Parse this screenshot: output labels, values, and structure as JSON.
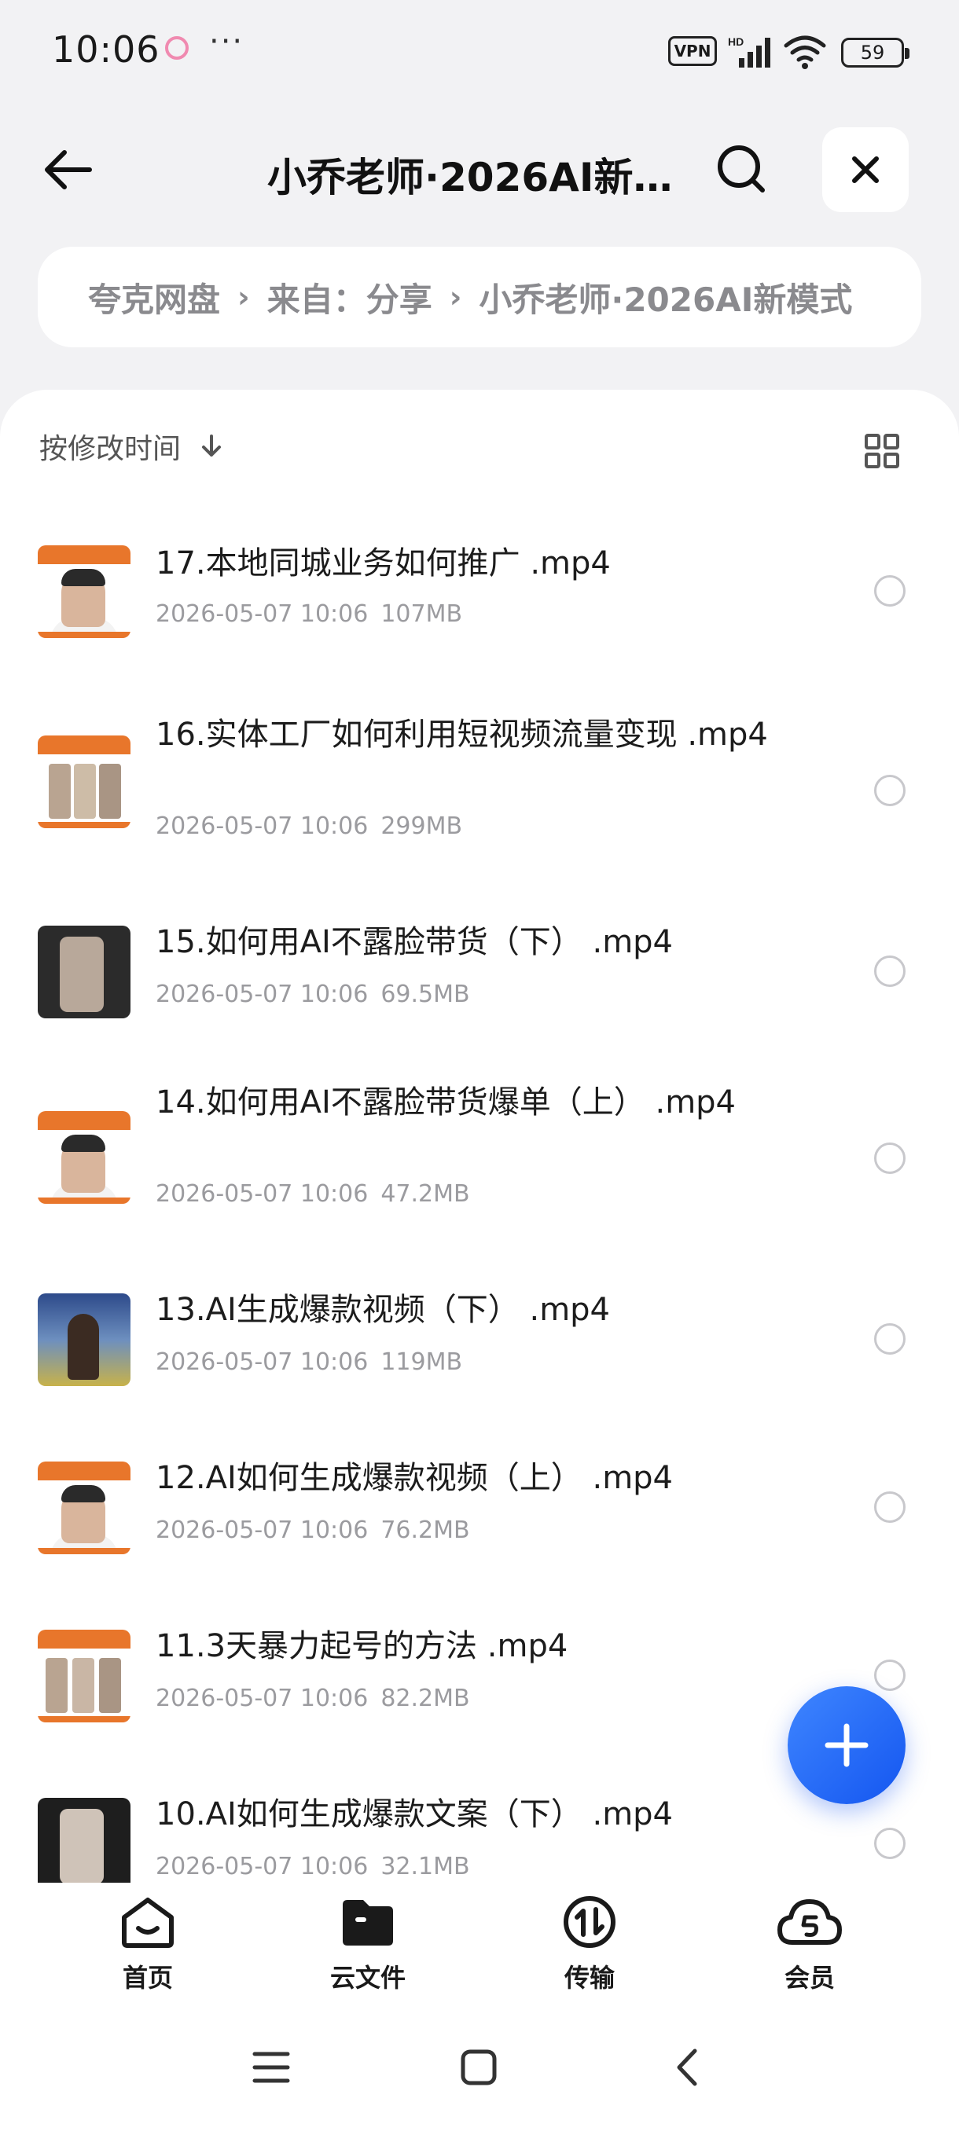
{
  "status_bar": {
    "time": "10:06",
    "more": "···",
    "vpn": "VPN",
    "hd": "HD",
    "battery": "59"
  },
  "header": {
    "title": "小乔老师·2026AI新…",
    "back_icon": "arrow-left-icon",
    "search_icon": "search-icon",
    "close_icon": "close-icon"
  },
  "breadcrumb": {
    "items": [
      "夸克网盘",
      "来自：分享",
      "小乔老师·2026AI新模式"
    ]
  },
  "toolbar": {
    "sort_label": "按修改时间",
    "sort_icon": "arrow-down-icon",
    "view_icon": "grid-view-icon"
  },
  "files": [
    {
      "name": "17.本地同城业务如何推广 .mp4",
      "date": "2026-05-07 10:06",
      "size": "107MB",
      "thumb": "orange-face"
    },
    {
      "name": "16.实体工厂如何利用短视频流量变现 .mp4",
      "date": "2026-05-07 10:06",
      "size": "299MB",
      "thumb": "orange-photos"
    },
    {
      "name": "15.如何用AI不露脸带货（下） .mp4",
      "date": "2026-05-07 10:06",
      "size": "69.5MB",
      "thumb": "dark-phone"
    },
    {
      "name": "14.如何用AI不露脸带货爆单（上） .mp4",
      "date": "2026-05-07 10:06",
      "size": "47.2MB",
      "thumb": "orange-face"
    },
    {
      "name": "13.AI生成爆款视频（下） .mp4",
      "date": "2026-05-07 10:06",
      "size": "119MB",
      "thumb": "sky-girl"
    },
    {
      "name": "12.AI如何生成爆款视频（上） .mp4",
      "date": "2026-05-07 10:06",
      "size": "76.2MB",
      "thumb": "orange-face"
    },
    {
      "name": "11.3天暴力起号的方法 .mp4",
      "date": "2026-05-07 10:06",
      "size": "82.2MB",
      "thumb": "orange-photos"
    },
    {
      "name": "10.AI如何生成爆款文案（下） .mp4",
      "date": "2026-05-07 10:06",
      "size": "32.1MB",
      "thumb": "dark-phone"
    }
  ],
  "fab": {
    "icon": "plus-icon"
  },
  "bottom_nav": [
    {
      "label": "首页",
      "icon": "home-icon"
    },
    {
      "label": "云文件",
      "icon": "folder-icon"
    },
    {
      "label": "传输",
      "icon": "transfer-icon"
    },
    {
      "label": "会员",
      "icon": "member-cloud-icon"
    }
  ],
  "system_nav": [
    "menu-icon",
    "home-square-icon",
    "back-chevron-icon"
  ],
  "colors": {
    "accent": "#1a5cf5",
    "thumb_orange": "#e8762b"
  }
}
